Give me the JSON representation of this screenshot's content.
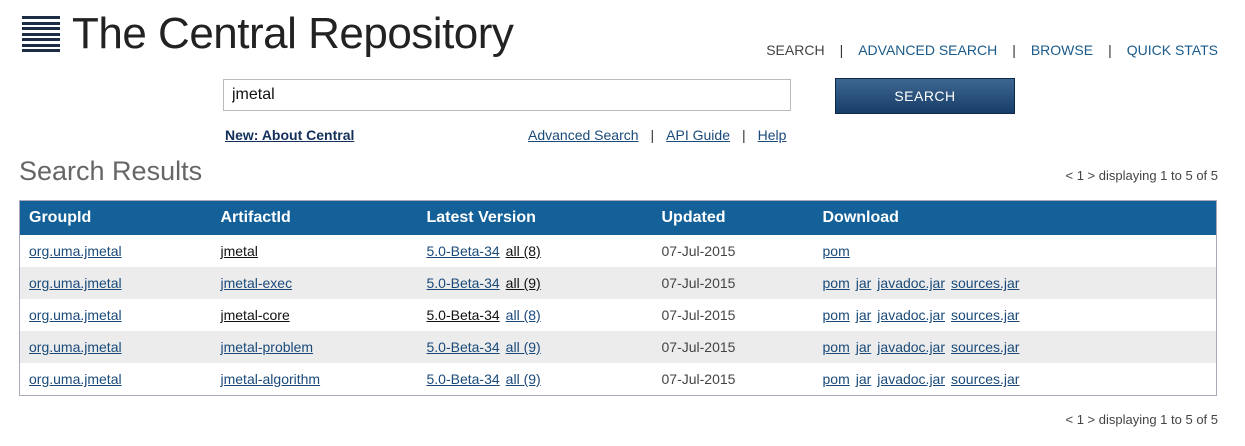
{
  "logo": {
    "title": "The Central Repository"
  },
  "nav": {
    "search": "SEARCH",
    "advanced_search": "ADVANCED SEARCH",
    "browse": "BROWSE",
    "quick_stats": "QUICK STATS",
    "separator": "|"
  },
  "search": {
    "value": "jmetal",
    "button_label": "SEARCH"
  },
  "links": {
    "new_about": "New: About Central",
    "advanced": "Advanced Search",
    "api_guide": "API Guide",
    "help": "Help",
    "separator": "|"
  },
  "results": {
    "title": "Search Results",
    "pager": "< 1 > displaying 1 to 5 of 5",
    "columns": [
      "GroupId",
      "ArtifactId",
      "Latest Version",
      "Updated",
      "Download"
    ],
    "rows": [
      {
        "group": "org.uma.jmetal",
        "artifact": "jmetal",
        "version": "5.0-Beta-34",
        "all": "all (8)",
        "updated": "07-Jul-2015",
        "downloads": [
          "pom"
        ]
      },
      {
        "group": "org.uma.jmetal",
        "artifact": "jmetal-exec",
        "version": "5.0-Beta-34",
        "all": "all (9)",
        "updated": "07-Jul-2015",
        "downloads": [
          "pom",
          "jar",
          "javadoc.jar",
          "sources.jar"
        ]
      },
      {
        "group": "org.uma.jmetal",
        "artifact": "jmetal-core",
        "version": "5.0-Beta-34",
        "all": "all (8)",
        "updated": "07-Jul-2015",
        "downloads": [
          "pom",
          "jar",
          "javadoc.jar",
          "sources.jar"
        ]
      },
      {
        "group": "org.uma.jmetal",
        "artifact": "jmetal-problem",
        "version": "5.0-Beta-34",
        "all": "all (9)",
        "updated": "07-Jul-2015",
        "downloads": [
          "pom",
          "jar",
          "javadoc.jar",
          "sources.jar"
        ]
      },
      {
        "group": "org.uma.jmetal",
        "artifact": "jmetal-algorithm",
        "version": "5.0-Beta-34",
        "all": "all (9)",
        "updated": "07-Jul-2015",
        "downloads": [
          "pom",
          "jar",
          "javadoc.jar",
          "sources.jar"
        ]
      }
    ]
  }
}
